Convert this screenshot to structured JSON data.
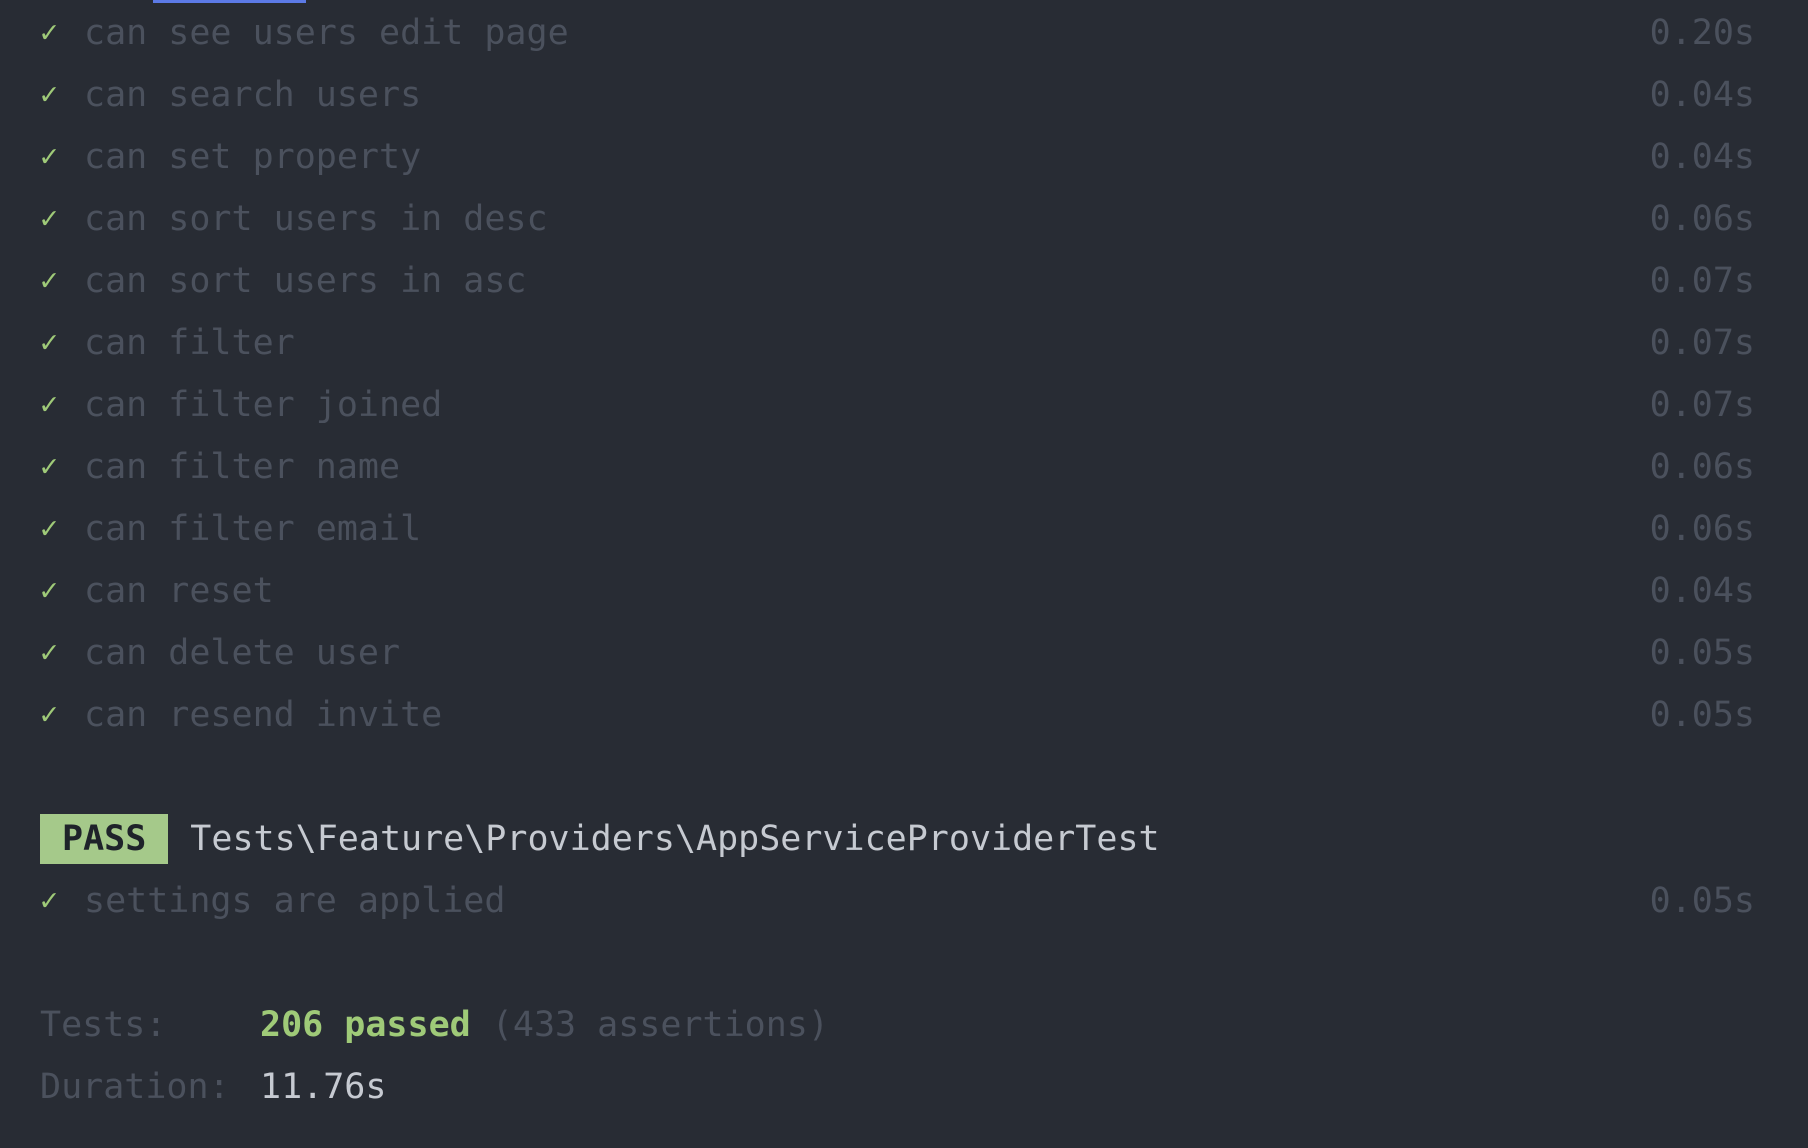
{
  "tests": [
    {
      "name": "can see users edit page",
      "time": "0.20s"
    },
    {
      "name": "can search users",
      "time": "0.04s"
    },
    {
      "name": "can set property",
      "time": "0.04s"
    },
    {
      "name": "can sort users in desc",
      "time": "0.06s"
    },
    {
      "name": "can sort users in asc",
      "time": "0.07s"
    },
    {
      "name": "can filter",
      "time": "0.07s"
    },
    {
      "name": "can filter joined",
      "time": "0.07s"
    },
    {
      "name": "can filter name",
      "time": "0.06s"
    },
    {
      "name": "can filter email",
      "time": "0.06s"
    },
    {
      "name": "can reset",
      "time": "0.04s"
    },
    {
      "name": "can delete user",
      "time": "0.05s"
    },
    {
      "name": "can resend invite",
      "time": "0.05s"
    }
  ],
  "suite": {
    "badge": "PASS",
    "path": "Tests\\Feature\\Providers\\AppServiceProviderTest",
    "tests": [
      {
        "name": "settings are applied",
        "time": "0.05s"
      }
    ]
  },
  "summary": {
    "tests_label": "Tests:",
    "passed": "206 passed",
    "assertions": "(433 assertions)",
    "duration_label": "Duration:",
    "duration": "11.76s"
  },
  "icons": {
    "check": "✓"
  },
  "colors": {
    "background": "#282c34",
    "pass_badge": "#a5c98a",
    "check": "#9fca78",
    "dim_text": "#4b515d",
    "bright_text": "#c6cad1",
    "tab_indicator": "#5c7ae6"
  }
}
